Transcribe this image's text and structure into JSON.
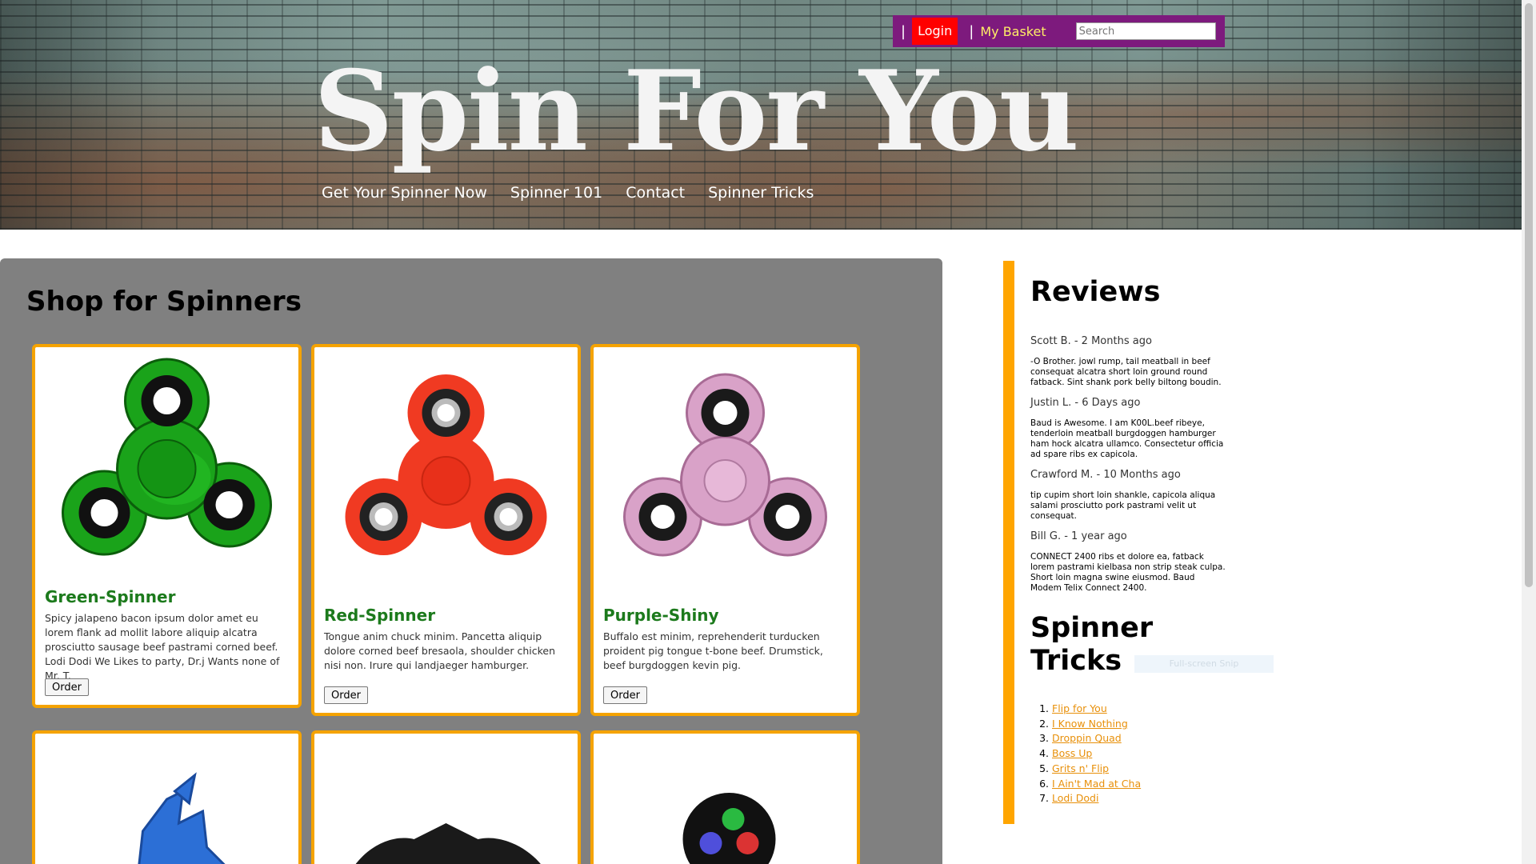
{
  "header": {
    "site_title": "Spin For You",
    "nav": [
      "Get Your Spinner Now",
      "Spinner 101",
      "Contact",
      "Spinner Tricks"
    ],
    "userbar": {
      "separator": "|",
      "login_label": "Login",
      "basket_label": "My Basket",
      "search_placeholder": "Search"
    }
  },
  "shop": {
    "title": "Shop for Spinners",
    "products": [
      {
        "name": "Green-Spinner",
        "color": "#1aa31a",
        "description": "Spicy jalapeno bacon ipsum dolor amet eu lorem flank ad mollit labore aliquip alcatra prosciutto sausage beef pastrami corned beef. Lodi Dodi We Likes to party, Dr.j Wants none of Mr. T.",
        "order_label": "Order"
      },
      {
        "name": "Red-Spinner",
        "color": "#f03a22",
        "description": "Tongue anim chuck minim. Pancetta aliquip dolore corned beef bresaola, shoulder chicken nisi non. Irure qui landjaeger hamburger.",
        "order_label": "Order"
      },
      {
        "name": "Purple-Shiny",
        "color": "#d9a2c8",
        "description": "Buffalo est minim, reprehenderit turducken proident pig tongue t-bone beef. Drumstick, beef burgdoggen kevin pig.",
        "order_label": "Order"
      },
      {
        "name": "",
        "color": "#2c6fd6"
      },
      {
        "name": "",
        "color": "#1a1a1a"
      },
      {
        "name": "",
        "color": "#1a1a1a"
      }
    ]
  },
  "sidebar": {
    "reviews_title": "Reviews",
    "reviews": [
      {
        "author": "Scott B. - 2 Months ago",
        "text": "-O Brother. jowl rump, tail meatball in beef consequat alcatra short loin ground round fatback. Sint shank pork belly biltong boudin."
      },
      {
        "author": "Justin L. - 6 Days ago",
        "text": "Baud is Awesome. I am K00L.beef ribeye, tenderloin meatball burgdoggen hamburger ham hock alcatra ullamco. Consectetur officia ad spare ribs ex capicola."
      },
      {
        "author": "Crawford M. - 10 Months ago",
        "text": "tip cupim short loin shankle, capicola aliqua salami prosciutto pork pastrami velit ut consequat."
      },
      {
        "author": "Bill G. - 1 year ago",
        "text": "CONNECT 2400 ribs et dolore ea, fatback lorem pastrami kielbasa non strip steak culpa. Short loin magna swine eiusmod. Baud Modem Telix Connect 2400."
      }
    ],
    "tricks_title": "Spinner Tricks",
    "faded_label": "Full-screen Snip",
    "tricks": [
      "Flip for You",
      "I Know Nothing",
      "Droppin Quad",
      "Boss Up",
      "Grits n' Flip",
      "I Ain't Mad at Cha",
      "Lodi Dodi"
    ]
  },
  "colors": {
    "accent_orange": "#ffa500",
    "userbar_purple": "#7d1a7d",
    "login_red": "#ff0000",
    "product_name_green": "#1c7a1c",
    "shop_panel_gray": "#808080"
  }
}
